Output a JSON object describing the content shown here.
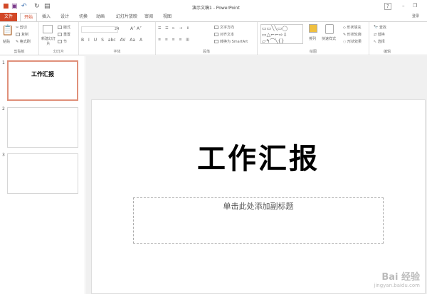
{
  "titlebar": {
    "title": "演示文稿1 - PowerPoint",
    "login": "登录",
    "help": "?",
    "min": "–",
    "restore": "❐"
  },
  "tabs": [
    "文件",
    "开始",
    "插入",
    "设计",
    "切换",
    "动画",
    "幻灯片放映",
    "审阅",
    "视图"
  ],
  "ribbon": {
    "clipboard": {
      "label": "剪贴板",
      "paste": "粘贴",
      "cut": "剪切",
      "copy": "复制",
      "format_painter": "格式刷"
    },
    "slides": {
      "label": "幻灯片",
      "new_slide": "新建幻灯片",
      "layout": "版式",
      "reset": "重置",
      "section": "节"
    },
    "font": {
      "label": "字体",
      "size": "24",
      "buttons": [
        "B",
        "I",
        "U",
        "S",
        "abc",
        "AV",
        "Aa",
        "A"
      ]
    },
    "paragraph": {
      "label": "段落",
      "text_direction": "文字方向",
      "align_text": "对齐文本",
      "smartart": "转换为 SmartArt"
    },
    "drawing": {
      "label": "绘图",
      "arrange": "排列",
      "quick_styles": "快速样式",
      "fill": "形状填充",
      "outline": "形状轮廓",
      "effects": "形状效果"
    },
    "editing": {
      "label": "编辑",
      "find": "查找",
      "replace": "替换",
      "select": "选择"
    }
  },
  "slides": [
    {
      "number": "1",
      "title": "工作汇报"
    },
    {
      "number": "2"
    },
    {
      "number": "3"
    }
  ],
  "slide": {
    "title": "工作汇报",
    "subtitle_placeholder": "单击此处添加副标题"
  },
  "watermark": {
    "logo": "Bai 经验",
    "url": "jingyan.baidu.com"
  },
  "colors": {
    "accent": "#d24726"
  }
}
